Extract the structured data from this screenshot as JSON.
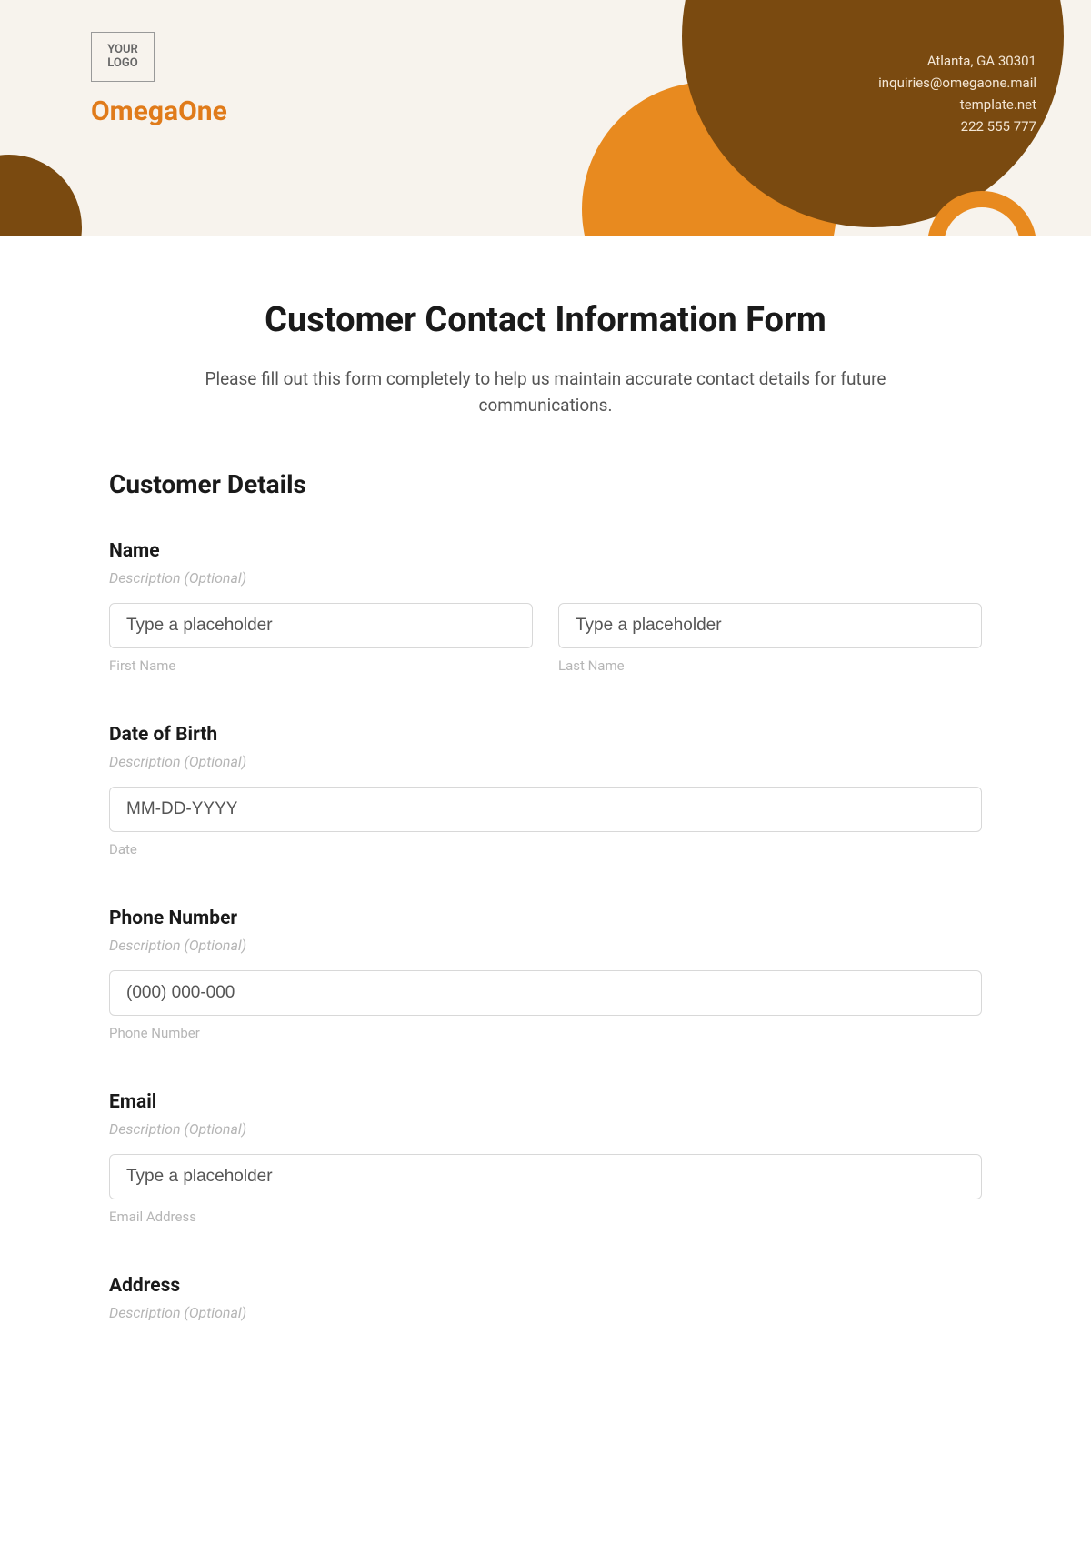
{
  "header": {
    "logo_text": "YOUR LOGO",
    "brand": "OmegaOne",
    "contact": {
      "address": "Atlanta, GA 30301",
      "email": "inquiries@omegaone.mail",
      "website": "template.net",
      "phone": "222 555 777"
    }
  },
  "form": {
    "title": "Customer Contact Information Form",
    "instructions": "Please fill out this form completely to help us maintain accurate contact details for future communications.",
    "section_heading": "Customer Details",
    "desc_optional": "Description (Optional)",
    "fields": {
      "name": {
        "label": "Name",
        "first_placeholder": "Type a placeholder",
        "first_sublabel": "First Name",
        "last_placeholder": "Type a placeholder",
        "last_sublabel": "Last Name"
      },
      "dob": {
        "label": "Date of Birth",
        "placeholder": "MM-DD-YYYY",
        "sublabel": "Date"
      },
      "phone": {
        "label": "Phone Number",
        "placeholder": "(000) 000-000",
        "sublabel": "Phone Number"
      },
      "email": {
        "label": "Email",
        "placeholder": "Type a placeholder",
        "sublabel": "Email Address"
      },
      "address": {
        "label": "Address"
      }
    }
  }
}
